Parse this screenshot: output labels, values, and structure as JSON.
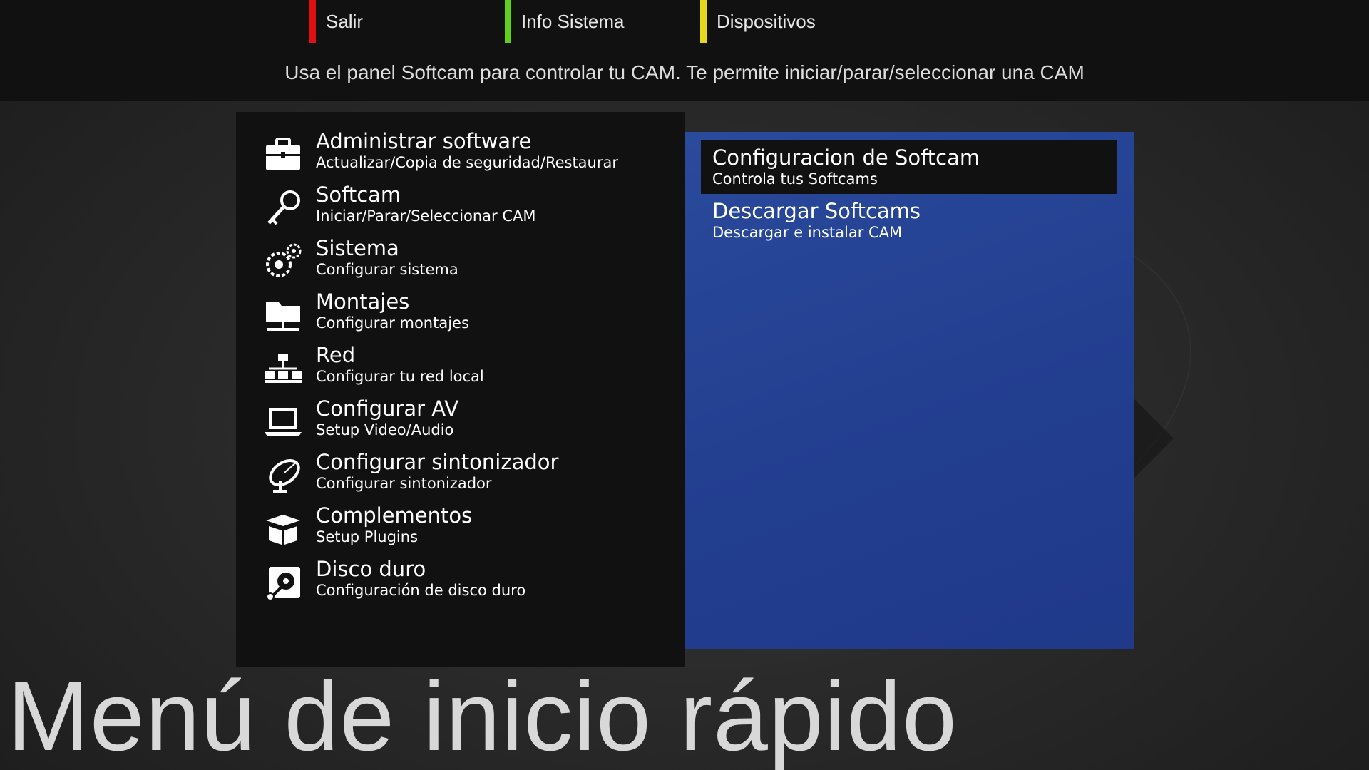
{
  "colors": {
    "red_key": "#e01010",
    "green_key": "#5fd01a",
    "yellow_key": "#e8d81a",
    "panel_bg": "#111111",
    "selection_panel_bg": "#233f90"
  },
  "color_keys": [
    {
      "label": "Salir",
      "color": "#e01010"
    },
    {
      "label": "Info Sistema",
      "color": "#5fd01a"
    },
    {
      "label": "Dispositivos",
      "color": "#e8d81a"
    }
  ],
  "hint": "Usa el panel Softcam para controlar tu CAM. Te permite iniciar/parar/seleccionar una CAM",
  "menu": [
    {
      "title": "Administrar software",
      "sub": "Actualizar/Copia de seguridad/Restaurar",
      "icon": "toolbox-icon"
    },
    {
      "title": "Softcam",
      "sub": "Iniciar/Parar/Seleccionar CAM",
      "icon": "key-icon"
    },
    {
      "title": "Sistema",
      "sub": "Configurar sistema",
      "icon": "gears-icon"
    },
    {
      "title": "Montajes",
      "sub": "Configurar montajes",
      "icon": "network-folder-icon"
    },
    {
      "title": "Red",
      "sub": "Configurar tu red local",
      "icon": "network-icon"
    },
    {
      "title": "Configurar AV",
      "sub": "Setup Video/Audio",
      "icon": "laptop-icon"
    },
    {
      "title": "Configurar sintonizador",
      "sub": "Configurar sintonizador",
      "icon": "satellite-dish-icon"
    },
    {
      "title": "Complementos",
      "sub": "Setup Plugins",
      "icon": "box-icon"
    },
    {
      "title": "Disco duro",
      "sub": "Configuración de disco duro",
      "icon": "hard-disk-icon"
    }
  ],
  "submenu": [
    {
      "title": "Configuracion de Softcam",
      "sub": "Controla tus Softcams",
      "selected": true
    },
    {
      "title": "Descargar Softcams",
      "sub": "Descargar e instalar CAM",
      "selected": false
    }
  ],
  "page_title": "Menú de inicio rápido"
}
